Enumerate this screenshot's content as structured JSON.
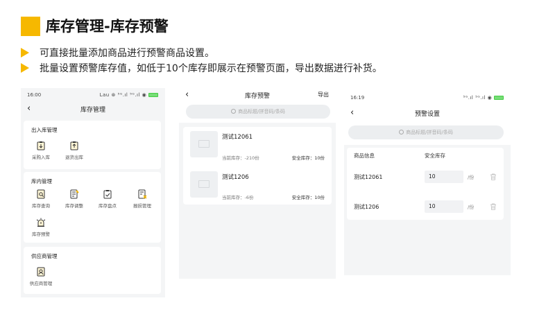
{
  "title": "库存管理-库存预警",
  "bullets": [
    "可直接批量添加商品进行预警商品设置。",
    "批量设置预警库存值，如低于10个库存即展示在预警页面，导出数据进行补货。"
  ],
  "colors": {
    "accent": "#f6b800"
  },
  "screen1": {
    "time": "16:00",
    "status_right": "Lau ⊛ ⁵ᴳ.ıl ⁵ᴳ.ıl ◉",
    "nav_title": "库存管理",
    "sections": [
      {
        "title": "出入库管理",
        "items": [
          {
            "label": "采购入库",
            "icon": "clipboard-in-icon"
          },
          {
            "label": "退货出库",
            "icon": "clipboard-out-icon"
          }
        ]
      },
      {
        "title": "库内管理",
        "items": [
          {
            "label": "库存查询",
            "icon": "search-doc-icon"
          },
          {
            "label": "库存调整",
            "icon": "edit-doc-icon"
          },
          {
            "label": "库存盘点",
            "icon": "check-clipboard-icon"
          },
          {
            "label": "报损管理",
            "icon": "damage-doc-icon"
          },
          {
            "label": "库存预警",
            "icon": "alarm-icon"
          }
        ]
      },
      {
        "title": "供应商管理",
        "items": [
          {
            "label": "供应商管理",
            "icon": "supplier-icon"
          }
        ]
      }
    ]
  },
  "screen2": {
    "nav_title": "库存预警",
    "nav_right": "导出",
    "search_placeholder": "商品标题/拼音码/条码",
    "products": [
      {
        "name": "测试12061",
        "stock": "当前库存：-210份",
        "safe": "安全库存：10份"
      },
      {
        "name": "测试1206",
        "stock": "当前库存：-6份",
        "safe": "安全库存：10份"
      }
    ]
  },
  "screen3": {
    "time": "16:19",
    "status_right": "⁵ᴳ.ıl ⁵ᴳ.ıl ◉",
    "nav_title": "预警设置",
    "search_placeholder": "商品标题/拼音码/条码",
    "col_product": "商品信息",
    "col_safe": "安全库存",
    "unit": "/份",
    "rows": [
      {
        "name": "测试12061",
        "value": "10"
      },
      {
        "name": "测试1206",
        "value": "10"
      }
    ]
  }
}
